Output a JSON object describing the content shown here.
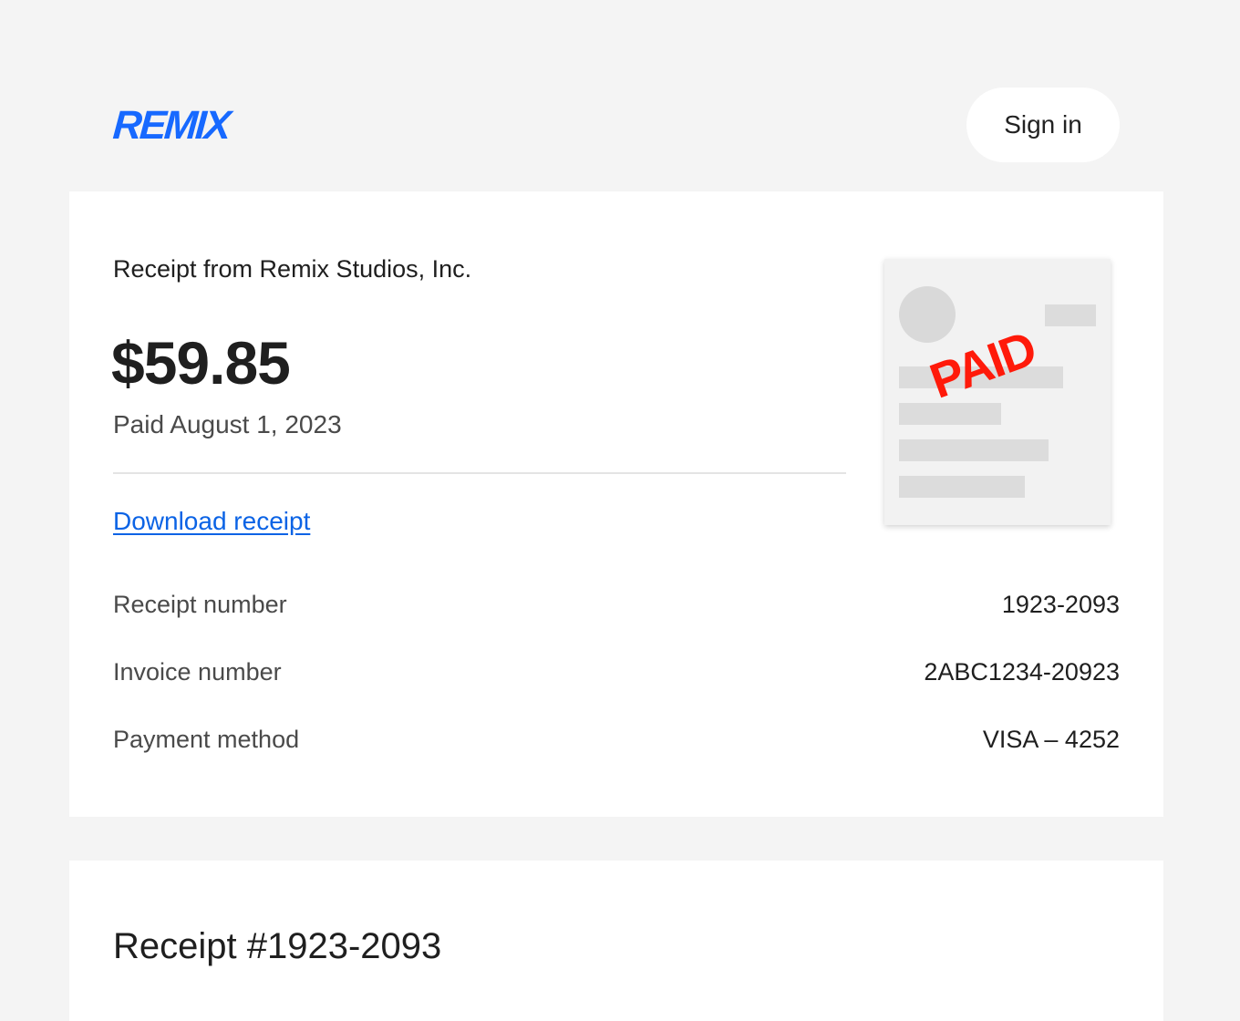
{
  "header": {
    "logo_text": "REMIX",
    "signin_label": "Sign in"
  },
  "summary": {
    "from_line": "Receipt from Remix Studios, Inc.",
    "amount": "$59.85",
    "paid_date": "Paid August 1, 2023",
    "download_label": "Download receipt",
    "stamp_text": "PAID",
    "details": [
      {
        "label": "Receipt number",
        "value": "1923-2093"
      },
      {
        "label": "Invoice number",
        "value": "2ABC1234-20923"
      },
      {
        "label": "Payment method",
        "value": "VISA – 4252"
      }
    ]
  },
  "receipt_section": {
    "title": "Receipt #1923-2093"
  },
  "colors": {
    "brand": "#1769ff",
    "link": "#0b63e5",
    "stamp": "#ff1a0a",
    "background": "#f4f4f4",
    "card": "#ffffff"
  }
}
